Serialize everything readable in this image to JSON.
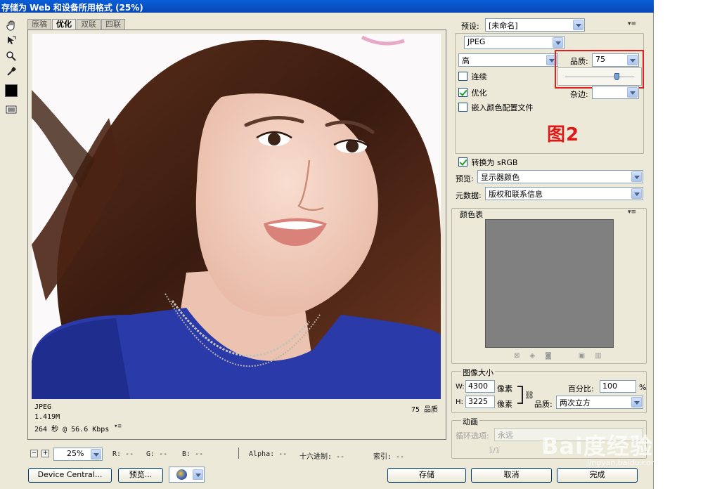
{
  "window": {
    "title": "存储为 Web 和设备所用格式 (25%)"
  },
  "tabs": [
    "原稿",
    "优化",
    "双联",
    "四联"
  ],
  "tools": [
    "hand-icon",
    "slice-select-icon",
    "zoom-icon",
    "eyedropper-icon",
    "color-swatch-icon",
    "toggle-slices-icon"
  ],
  "accent_color": "#0a5ed8",
  "image_info": {
    "format": "JPEG",
    "size": "1.419M",
    "time": "264 秒 @ 56.6 Kbps",
    "quality": "75 品质"
  },
  "statusbar": {
    "zoom": "25%",
    "r": "R: --",
    "g": "G: --",
    "b": "B: --",
    "alpha": "Alpha: --",
    "hex": "十六进制: --",
    "index": "索引: --"
  },
  "buttons": {
    "device_central": "Device Central...",
    "preview": "预览...",
    "save": "存储",
    "cancel": "取消",
    "done": "完成"
  },
  "settings": {
    "preset_label": "预设:",
    "preset_value": "[未命名]",
    "format": "JPEG",
    "quality_level": "高",
    "quality_label": "品质:",
    "quality_value": "75",
    "quality_slider": 0.75,
    "progressive": "连续",
    "optimized": "优化",
    "embed_profile": "嵌入颜色配置文件",
    "matte_label": "杂边:",
    "annotation": "图2",
    "convert_srgb": "转换为 sRGB",
    "preview_label": "预览:",
    "preview_value": "显示器颜色",
    "metadata_label": "元数据:",
    "metadata_value": "版权和联系信息"
  },
  "color_table": {
    "title": "颜色表",
    "swatch_color": "#808080"
  },
  "image_size": {
    "title": "图像大小",
    "w_label": "W:",
    "w_value": "4300",
    "h_label": "H:",
    "h_value": "3225",
    "unit": "像素",
    "percent_label": "百分比:",
    "percent_value": "100",
    "percent_sign": "%",
    "quality_label": "品质:",
    "quality_value": "两次立方"
  },
  "animation": {
    "title": "动画",
    "loop_label": "循环选项:",
    "loop_value": "永远",
    "frame_counter": "1/1"
  },
  "watermark": {
    "text": "Bai度经验",
    "url": "jingyan.baidu.com"
  }
}
